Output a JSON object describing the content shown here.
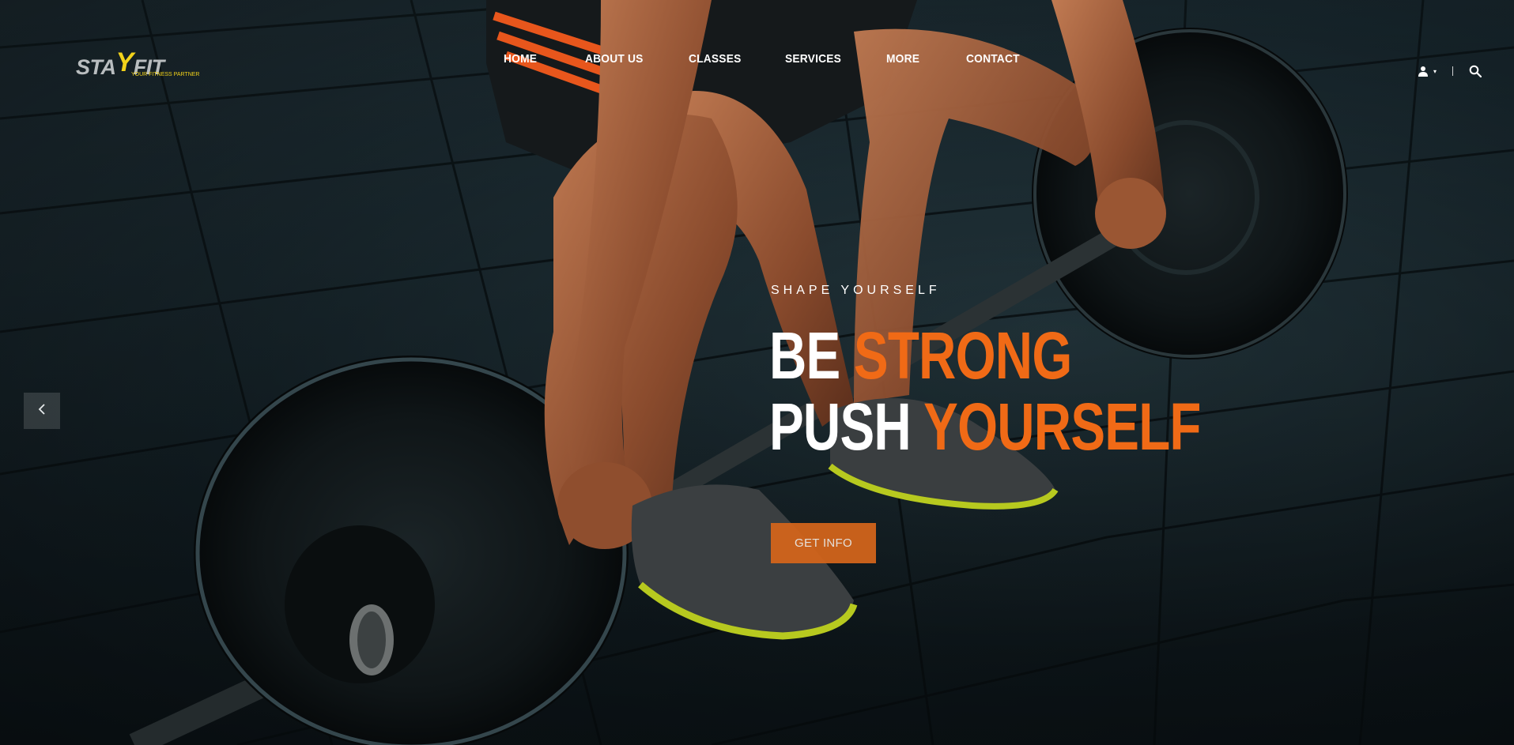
{
  "brand": {
    "logo_text_a": "STA",
    "logo_text_y": "Y",
    "logo_text_b": "FIT",
    "tagline": "YOUR FITNESS PARTNER",
    "logo_gray": "#b9bdbf",
    "logo_yellow": "#f2d21a"
  },
  "nav": {
    "items": [
      {
        "label": "HOME"
      },
      {
        "label": "ABOUT US"
      },
      {
        "label": "CLASSES"
      },
      {
        "label": "SERVICES"
      },
      {
        "label": "MORE"
      },
      {
        "label": "CONTACT"
      }
    ]
  },
  "header_icons": {
    "account": "user-icon",
    "dropdown": "caret-down-icon",
    "search": "search-icon"
  },
  "slider": {
    "prev_icon": "chevron-left-icon"
  },
  "hero": {
    "eyebrow": "SHAPE YOURSELF",
    "line1_white": "BE",
    "line1_accent": "STRONG",
    "line2_white": "PUSH",
    "line2_accent": "YOURSELF",
    "cta_label": "GET INFO",
    "accent_color": "#f06a16",
    "cta_color": "#d7661b"
  }
}
